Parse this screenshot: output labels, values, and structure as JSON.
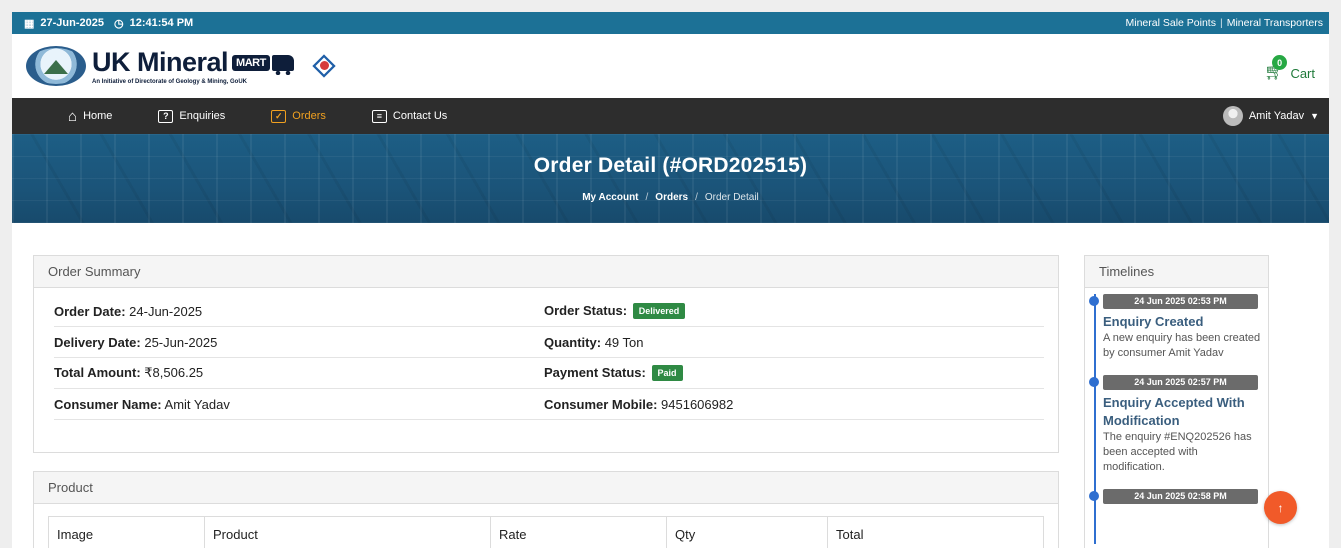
{
  "topbar": {
    "date": "27-Jun-2025",
    "time": "12:41:54 PM",
    "links": [
      "Mineral Sale Points",
      "Mineral Transporters"
    ],
    "separator": "|"
  },
  "brand": {
    "title": "UK Mineral",
    "mart": "MART",
    "subtitle": "An Initiative of Directorate of Geology & Mining, GoUK"
  },
  "cart": {
    "count": "0",
    "label": "Cart"
  },
  "nav": {
    "items": [
      {
        "label": "Home",
        "icon": "home-icon"
      },
      {
        "label": "Enquiries",
        "icon": "question-box-icon",
        "glyph": "?"
      },
      {
        "label": "Orders",
        "icon": "bag-check-icon",
        "glyph": "✓"
      },
      {
        "label": "Contact Us",
        "icon": "message-box-icon",
        "glyph": "≡"
      }
    ],
    "active": "Orders",
    "user": "Amit Yadav"
  },
  "hero": {
    "title": "Order Detail (#ORD202515)",
    "breadcrumb": [
      "My Account",
      "Orders",
      "Order Detail"
    ],
    "sep": "/"
  },
  "summary": {
    "heading": "Order Summary",
    "order_date_label": "Order Date:",
    "order_date": "24-Jun-2025",
    "order_status_label": "Order Status:",
    "order_status": "Delivered",
    "delivery_date_label": "Delivery Date:",
    "delivery_date": "25-Jun-2025",
    "quantity_label": "Quantity:",
    "quantity": "49 Ton",
    "total_label": "Total Amount:",
    "total": "₹8,506.25",
    "payment_label": "Payment Status:",
    "payment": "Paid",
    "consumer_label": "Consumer Name:",
    "consumer": "Amit Yadav",
    "mobile_label": "Consumer Mobile:",
    "mobile": "9451606982"
  },
  "product": {
    "heading": "Product",
    "columns": [
      "Image",
      "Product",
      "Rate",
      "Qty",
      "Total"
    ]
  },
  "timeline": {
    "heading": "Timelines",
    "items": [
      {
        "date": "24 Jun 2025 02:53 PM",
        "title": "Enquiry Created",
        "desc": "A new enquiry has been created by consumer Amit Yadav"
      },
      {
        "date": "24 Jun 2025 02:57 PM",
        "title": "Enquiry Accepted With Modification",
        "desc": "The enquiry #ENQ202526 has been accepted with modification."
      },
      {
        "date": "24 Jun 2025 02:58 PM",
        "title": "",
        "desc": ""
      }
    ]
  },
  "colors": {
    "topbar": "#1c7196",
    "nav": "#2d2d2d",
    "active": "#f0a020",
    "badge": "#2f8a44",
    "scrolltop": "#f15a29",
    "timeline": "#2f6fd0"
  }
}
